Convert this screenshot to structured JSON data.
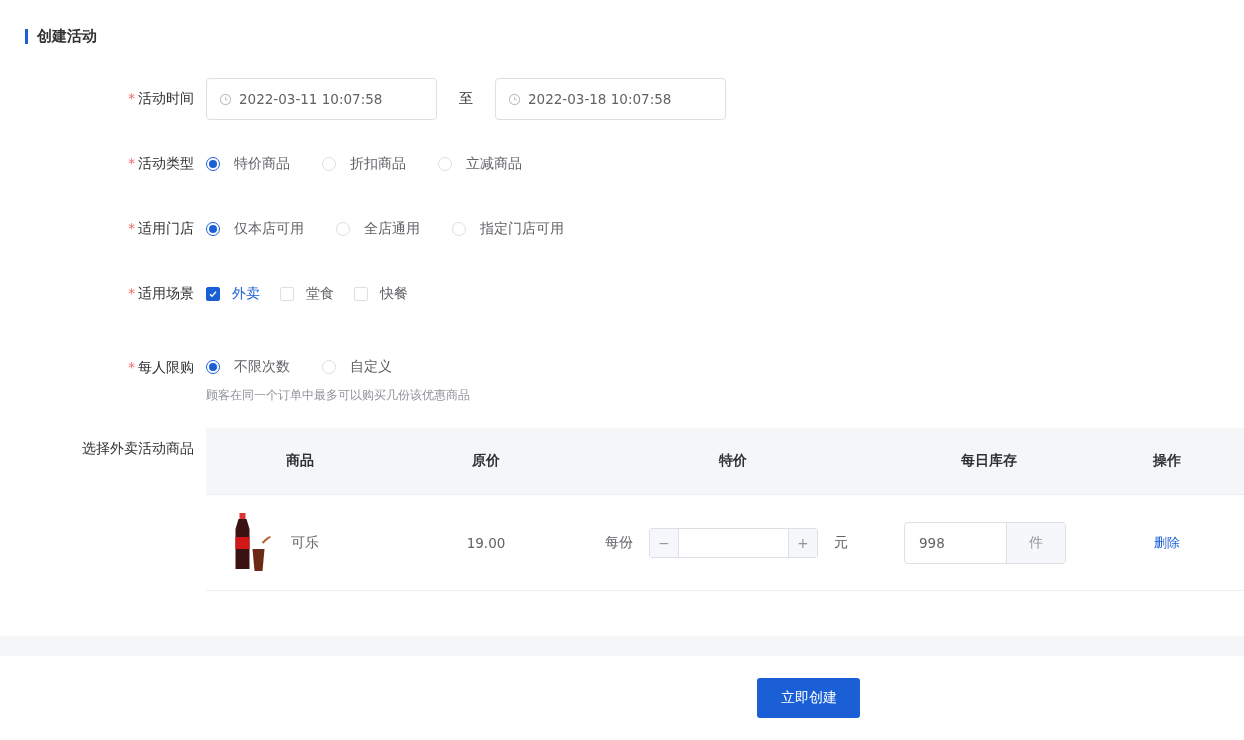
{
  "title": "创建活动",
  "time": {
    "label": "活动时间",
    "mark": "*",
    "start": "2022-03-11 10:07:58",
    "separator": "至",
    "end": "2022-03-18 10:07:58"
  },
  "fields": [
    {
      "kind": "radio",
      "label": "活动类型",
      "mark": "*",
      "options": [
        {
          "label": "特价商品",
          "selected": true
        },
        {
          "label": "折扣商品",
          "selected": false
        },
        {
          "label": "立减商品",
          "selected": false
        }
      ]
    },
    {
      "kind": "radio",
      "label": "适用门店",
      "mark": "*",
      "options": [
        {
          "label": "仅本店可用",
          "selected": true
        },
        {
          "label": "全店通用",
          "selected": false
        },
        {
          "label": "指定门店可用",
          "selected": false
        }
      ]
    },
    {
      "kind": "checkbox",
      "label": "适用场景",
      "mark": "*",
      "options": [
        {
          "label": "外卖",
          "checked": true
        },
        {
          "label": "堂食",
          "checked": false
        },
        {
          "label": "快餐",
          "checked": false
        }
      ]
    },
    {
      "kind": "radio",
      "label": "每人限购",
      "mark": "*",
      "options": [
        {
          "label": "不限次数",
          "selected": true
        },
        {
          "label": "自定义",
          "selected": false
        }
      ],
      "hint": "顾客在同一个订单中最多可以购买几份该优惠商品"
    }
  ],
  "products": {
    "label": "选择外卖活动商品",
    "columns": [
      "商品",
      "原价",
      "特价",
      "每日库存",
      "操作"
    ],
    "rows": [
      {
        "name": "可乐",
        "price": "19.00",
        "per": "每份",
        "minus": "−",
        "plus": "+",
        "unit": "元",
        "stock": "998",
        "stock_unit": "件",
        "action": "删除"
      }
    ]
  },
  "submit": "立即创建"
}
